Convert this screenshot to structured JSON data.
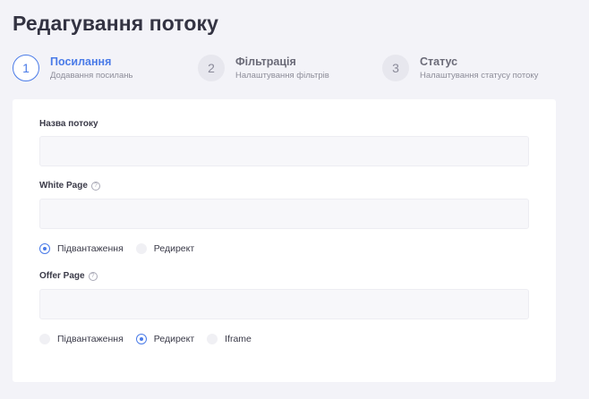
{
  "page": {
    "title": "Редагування потоку"
  },
  "stepper": {
    "steps": [
      {
        "number": "1",
        "title": "Посилання",
        "subtitle": "Додавання посилань",
        "active": true
      },
      {
        "number": "2",
        "title": "Фільтрація",
        "subtitle": "Налаштування фільтрів",
        "active": false
      },
      {
        "number": "3",
        "title": "Статус",
        "subtitle": "Налаштування статусу потоку",
        "active": false
      }
    ]
  },
  "form": {
    "stream_name": {
      "label": "Назва потоку",
      "value": "",
      "placeholder": ""
    },
    "white_page": {
      "label": "White Page",
      "help": "?",
      "value": "",
      "placeholder": "",
      "options": [
        {
          "label": "Підвантаження",
          "checked": true
        },
        {
          "label": "Редирект",
          "checked": false
        }
      ]
    },
    "offer_page": {
      "label": "Offer Page",
      "help": "?",
      "value": "",
      "placeholder": "",
      "options": [
        {
          "label": "Підвантаження",
          "checked": false
        },
        {
          "label": "Редирект",
          "checked": true
        },
        {
          "label": "Iframe",
          "checked": false
        }
      ]
    }
  },
  "colors": {
    "accent": "#4a7be8",
    "background": "#f3f3f8",
    "card": "#ffffff"
  }
}
